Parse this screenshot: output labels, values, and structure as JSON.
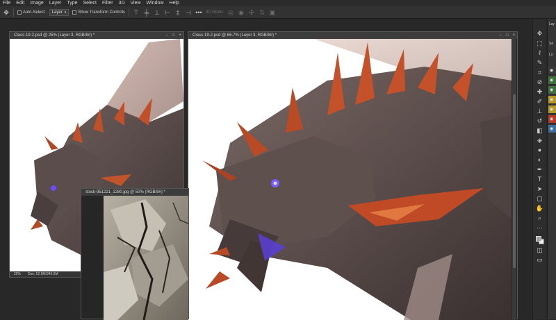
{
  "menu": [
    "File",
    "Edit",
    "Image",
    "Layer",
    "Type",
    "Select",
    "Filter",
    "3D",
    "View",
    "Window",
    "Help"
  ],
  "options_bar": {
    "tool_icon": "move-icon",
    "auto_select_label": "Auto-Select:",
    "auto_select_target": "Layer",
    "show_transform_label": "Show Transform Controls",
    "mode_3d_label": "3D Mode:",
    "align_icons": [
      "align-top-icon",
      "align-vcenter-icon",
      "align-bottom-icon",
      "align-left-icon",
      "align-hcenter-icon",
      "align-right-icon"
    ]
  },
  "documents": {
    "left": {
      "title": "Class-19-2.psd @ 25% (Layer 3, RGB/8#) *",
      "zoom": "25%",
      "docinfo": "Doc: 52.9M/340.6M"
    },
    "photo": {
      "title": "stock-951221_1280.jpg @ 50% (RGB/8#) *"
    },
    "main": {
      "title": "Class-19-2.psd @ 66.7% (Layer 3, RGB/8#) *"
    }
  },
  "window_controls": [
    "–",
    "□",
    "×"
  ],
  "tools": [
    "move-icon",
    "marquee-icon",
    "lasso-icon",
    "quick-select-icon",
    "crop-icon",
    "eyedropper-icon",
    "healing-icon",
    "brush-icon",
    "stamp-icon",
    "history-brush-icon",
    "eraser-icon",
    "gradient-icon",
    "blur-icon",
    "dodge-icon",
    "pen-icon",
    "type-icon",
    "path-select-icon",
    "shape-icon",
    "hand-icon",
    "zoom-icon",
    "more-icon"
  ],
  "colors": {
    "foreground": "#9f9f9f",
    "background": "#efefef",
    "layer_colors": [
      "#3f6e3f",
      "#3f6e3f",
      "#b49a2a",
      "#b49a2a",
      "#b43a2a",
      "#3f6e9a"
    ]
  },
  "right_panel": {
    "tab_label": "Lay",
    "search_label": "Se",
    "lock_label": "Lo"
  }
}
